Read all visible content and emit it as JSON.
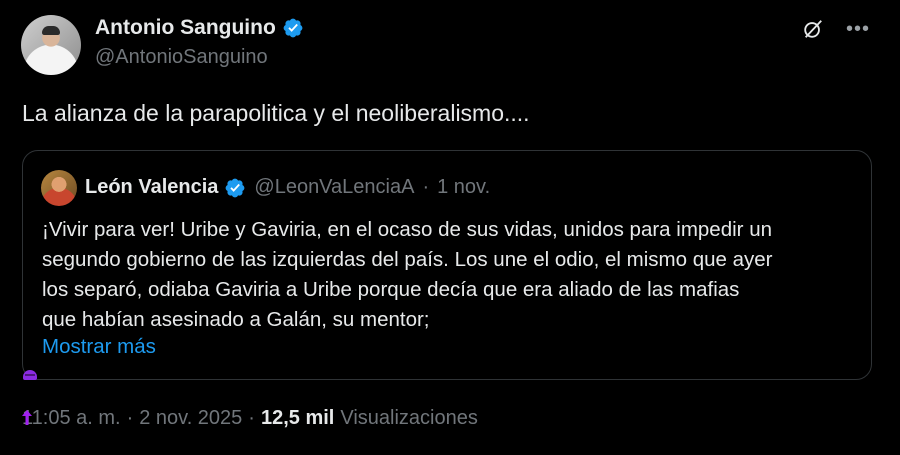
{
  "tweet": {
    "author_name": "Antonio Sanguino",
    "author_handle": "@AntonioSanguino",
    "text": "La alianza de la parapolitica y el neoliberalismo....",
    "time": "11:05 a. m.",
    "date": "2 nov. 2025",
    "separator": "·",
    "views_count": "12,5 mil",
    "views_label": "Visualizaciones"
  },
  "quote": {
    "author_name": "León Valencia",
    "author_handle": "@LeonVaLenciaA",
    "separator": "·",
    "date": "1 nov.",
    "lines": [
      "¡Vivir para ver! Uribe y Gaviria, en el ocaso de sus vidas, unidos para impedir un",
      "segundo gobierno de las izquierdas del país. Los une el odio, el mismo que ayer",
      "los separó, odiaba Gaviria a Uribe porque decía que era aliado de las mafias",
      "que habían asesinado a Galán, su mentor;"
    ],
    "show_more": "Mostrar más"
  },
  "icons": {
    "verified": "verified-badge-icon",
    "grok": "grok-icon",
    "more": "more-options-icon"
  },
  "colors": {
    "background": "#000000",
    "text": "#e7e9ea",
    "muted": "#71767b",
    "accent": "#1d9bf0",
    "border": "#2f3336"
  }
}
